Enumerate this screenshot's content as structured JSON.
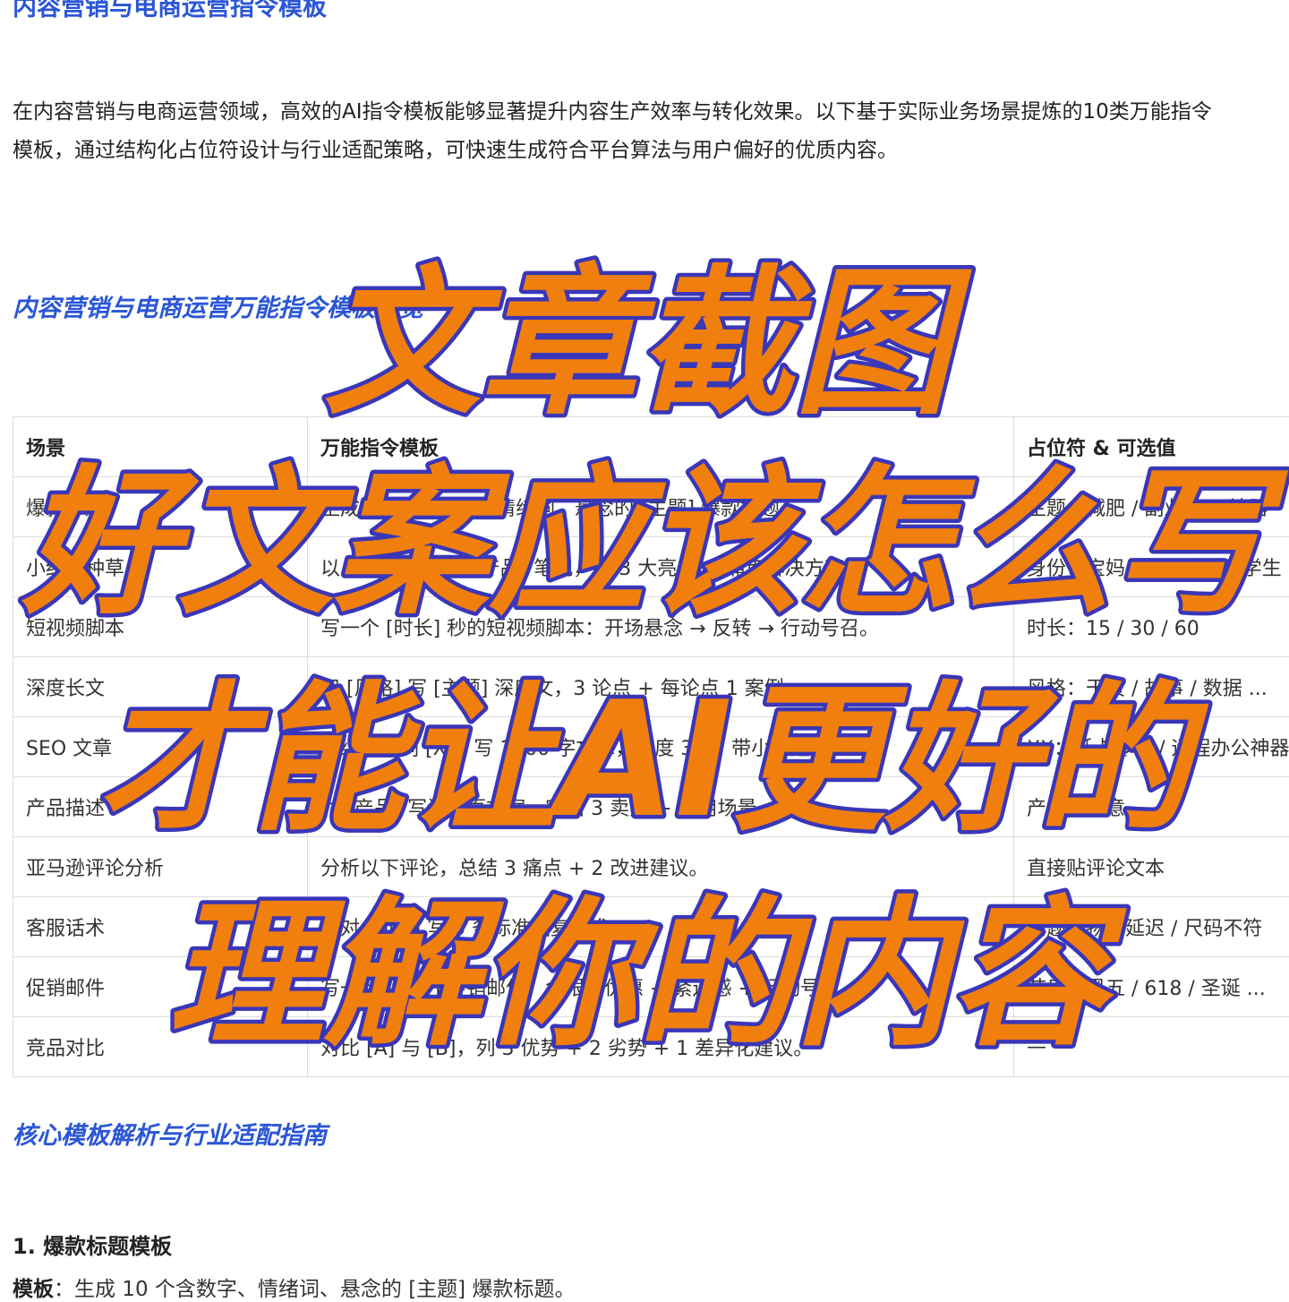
{
  "page_title": "内容营销与电商运营指令模板",
  "intro": "在内容营销与电商运营领域，高效的AI指令模板能够显著提升内容生产效率与转化效果。以下基于实际业务场景提炼的10类万能指令模板，通过结构化占位符设计与行业适配策略，可快速生成符合平台算法与用户偏好的优质内容。",
  "overview_heading": "内容营销与电商运营万能指令模板总览",
  "table": {
    "headers": [
      "场景",
      "万能指令模板",
      "占位符 & 可选值"
    ],
    "rows": [
      [
        "爆款标题",
        "生成 10 个含数字、情绪词、悬念的 [主题] 爆款标题。",
        "主题：减肥 / 副业 / AI 神器"
      ],
      [
        "小红书种草",
        "以 [身份] 口吻写 [产品] 笔记，列 3 大亮点 + 痛点解决方案。",
        "身份：宝妈 / 打工人 / 留学生"
      ],
      [
        "短视频脚本",
        "写一个 [时长] 秒的短视频脚本：开场悬念 → 反转 → 行动号召。",
        "时长：15 / 30 / 60"
      ],
      [
        "深度长文",
        "用 [风格] 写 [主题] 深度文，3 论点 + 每论点 1 案例。",
        "风格：干货 / 故事 / 数据 ..."
      ],
      [
        "SEO 文章",
        "围绕关键词 [XX] 写 1000 字文章，密度 3%，带小标题。",
        "XX：低卡零食 / 远程办公神器"
      ],
      [
        "产品描述",
        "为 [产品] 写详情页文案，突出 3 卖点 + 使用场景。",
        "产品：任意"
      ],
      [
        "亚马逊评论分析",
        "分析以下评论，总结 3 痛点 + 2 改进建议。",
        "直接贴评论文本"
      ],
      [
        "客服话术",
        "针对 [问题] 写 5 条标准回复话术。",
        "问题：物流延迟 / 尺码不符"
      ],
      [
        "促销邮件",
        "写一封 [节日] 促销邮件，含限时优惠 + 紧迫感 + 行动号召。",
        "节日：黑五 / 618 / 圣诞 ..."
      ],
      [
        "竞品对比",
        "对比 [A] 与 [B]，列 3 优势 + 2 劣势 + 1 差异化建议。",
        "—"
      ]
    ]
  },
  "core_heading": "核心模板解析与行业适配指南",
  "sub_heading": "1. 爆款标题模板",
  "template_label": "模板",
  "template_text": "：生成 10 个含数字、情绪词、悬念的 [主题] 爆款标题。",
  "overlay": {
    "line1": "文章截图",
    "line2": "好文案应该怎么写",
    "line3": "才能让AI更好的",
    "line4": "理解你的内容",
    "fill_color": "#f07f0e",
    "stroke_color": "#3a36b8"
  },
  "colors": {
    "heading_blue": "#2a56d6"
  }
}
